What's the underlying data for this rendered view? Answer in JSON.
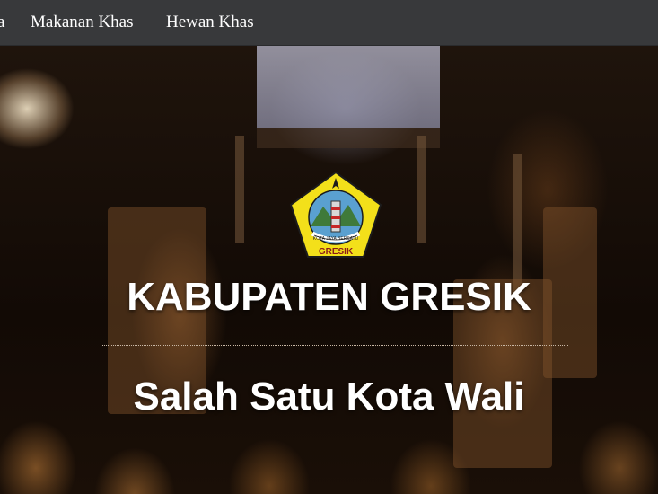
{
  "nav": {
    "items": [
      {
        "label": "a"
      },
      {
        "label": "Makanan Khas"
      },
      {
        "label": "Hewan Khas"
      }
    ]
  },
  "hero": {
    "logo_icon": "gresik-coat-of-arms-icon",
    "logo_text": "GRESIK",
    "logo_motto": "KOTA JAYA BERSATU",
    "title": "KABUPATEN GRESIK",
    "subtitle": "Salah Satu Kota Wali"
  },
  "colors": {
    "navbar": "#38393b",
    "text": "#ffffff",
    "logo_yellow": "#f3e01a"
  }
}
